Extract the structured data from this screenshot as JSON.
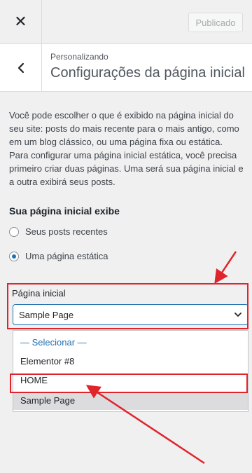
{
  "topbar": {
    "close_icon": "close-icon",
    "publish_label": "Publicado"
  },
  "header": {
    "back_icon": "chevron-left-icon",
    "breadcrumb": "Personalizando",
    "title": "Configurações da página inicial"
  },
  "description": "Você pode escolher o que é exibido na página inicial do seu site: posts do mais recente para o mais antigo, como em um blog clássico, ou uma página fixa ou estática. Para configurar uma página inicial estática, você precisa primeiro criar duas páginas. Uma será sua página inicial e a outra exibirá seus posts.",
  "homepage_displays": {
    "label": "Sua página inicial exibe",
    "options": [
      {
        "label": "Seus posts recentes",
        "checked": false
      },
      {
        "label": "Uma página estática",
        "checked": true
      }
    ]
  },
  "front_page": {
    "label": "Página inicial",
    "selected": "Sample Page",
    "options": [
      "— Selecionar —",
      "Elementor #8",
      "HOME",
      "Sample Page"
    ]
  },
  "annotation_color": "#e0242c",
  "accent_color": "#2271b1"
}
